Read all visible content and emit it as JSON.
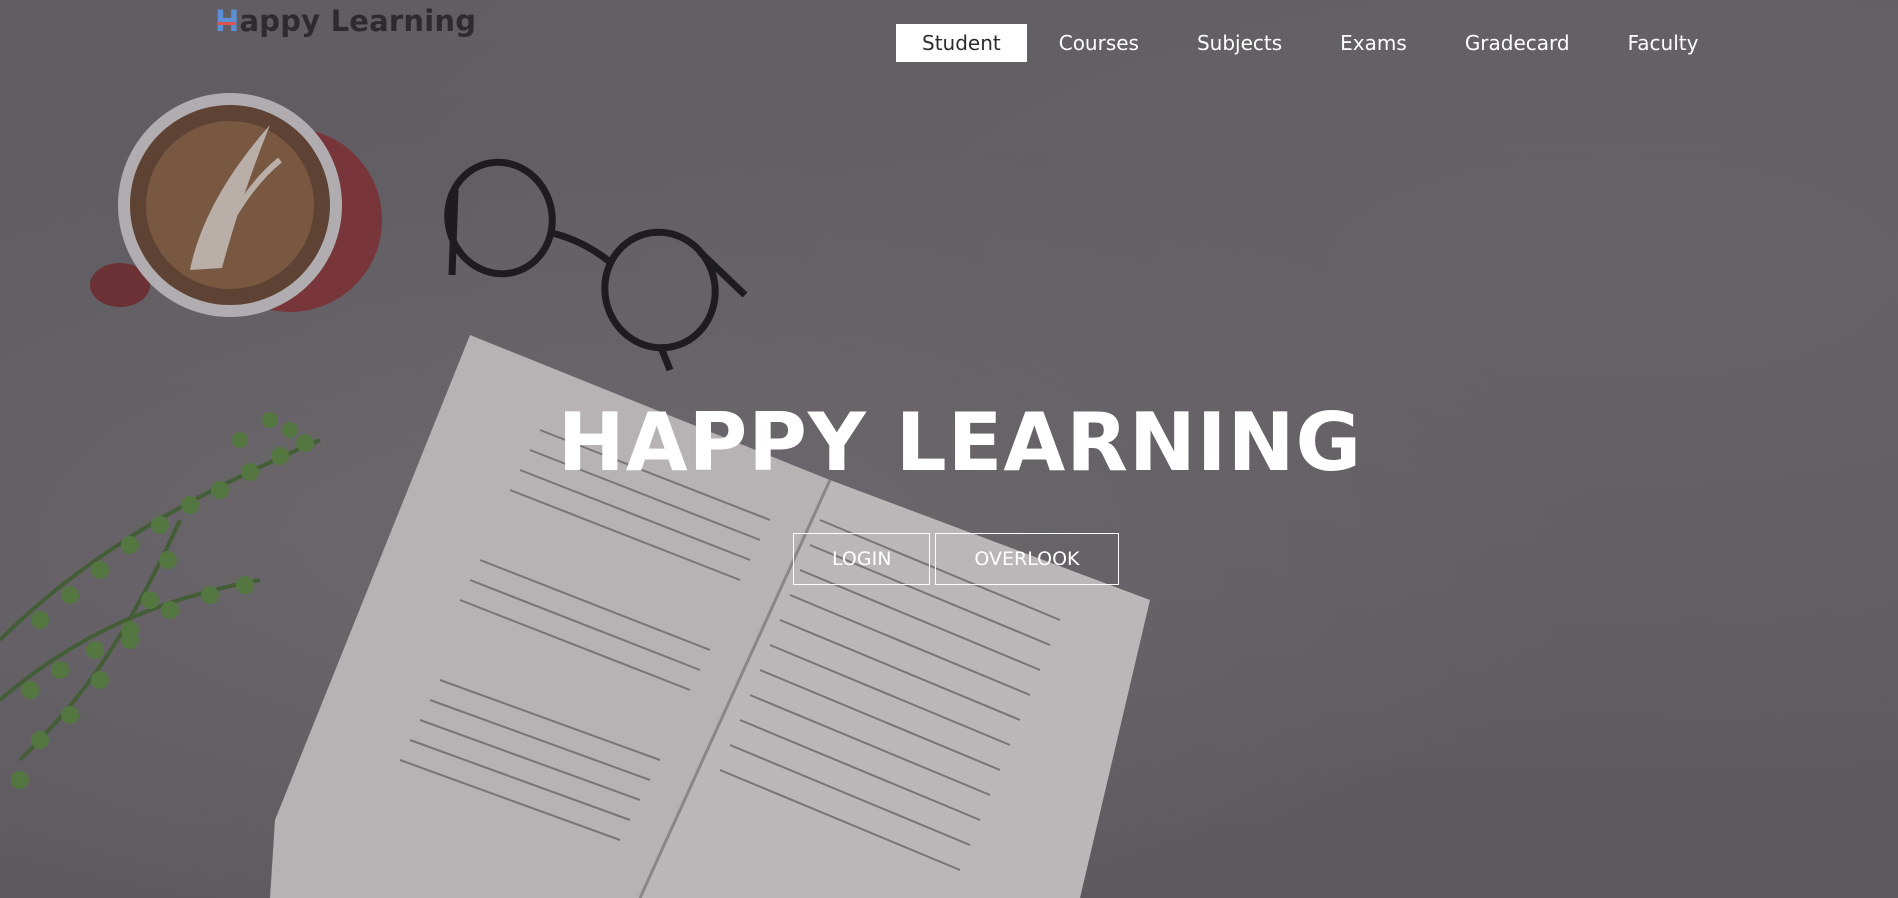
{
  "brand": {
    "logo_initial": "H",
    "logo_rest": "appy Learning"
  },
  "nav": {
    "items": [
      {
        "label": "Student",
        "active": true
      },
      {
        "label": "Courses",
        "active": false
      },
      {
        "label": "Subjects",
        "active": false
      },
      {
        "label": "Exams",
        "active": false
      },
      {
        "label": "Gradecard",
        "active": false
      },
      {
        "label": "Faculty",
        "active": false
      }
    ]
  },
  "hero": {
    "title": "HAPPY LEARNING",
    "buttons": {
      "login": "LOGIN",
      "overlook": "OVERLOOK"
    }
  },
  "colors": {
    "logo_accent_blue": "#5b8fd6",
    "logo_accent_red": "#d9534f",
    "text_light": "#ffffff",
    "active_nav_bg": "#ffffff"
  },
  "background": {
    "subject": "desk-scene-photo"
  }
}
